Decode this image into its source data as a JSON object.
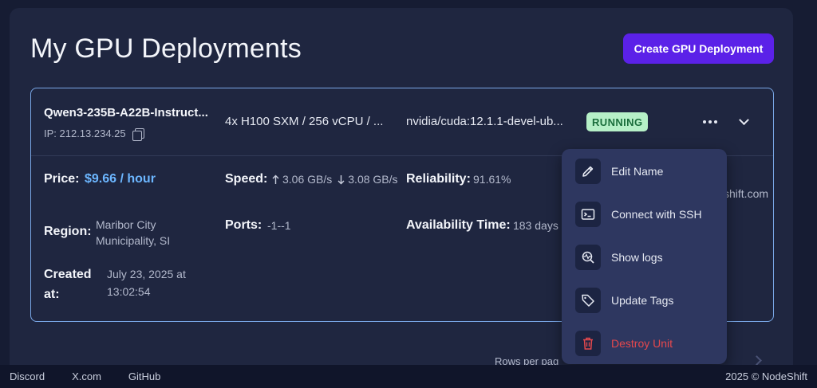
{
  "page": {
    "title": "My GPU Deployments",
    "create_label": "Create GPU Deployment"
  },
  "deployment": {
    "name": "Qwen3-235B-A22B-Instruct...",
    "ip": "IP: 212.13.234.25",
    "hardware": "4x H100 SXM / 256 vCPU / ...",
    "image": "nvidia/cuda:12.1.1-devel-ub...",
    "status": "RUNNING",
    "price_label": "Price:",
    "price_value": "$9.66 / hour",
    "speed_label": "Speed:",
    "speed_up": "3.06 GB/s",
    "speed_down": "3.08 GB/s",
    "reliability_label": "Reliability:",
    "reliability_value": "91.61%",
    "email_partial": "shift.com",
    "region_label": "Region:",
    "region_value_1": "Maribor City",
    "region_value_2": "Municipality, SI",
    "ports_label": "Ports:",
    "ports_value": "-1--1",
    "availability_label": "Availability Time:",
    "availability_value": "183 days",
    "created_label_1": "Created",
    "created_label_2": "at:",
    "created_value_1": "July 23, 2025 at",
    "created_value_2": "13:02:54"
  },
  "menu": {
    "items": [
      {
        "label": "Edit Name",
        "icon": "pencil-icon"
      },
      {
        "label": "Connect with SSH",
        "icon": "terminal-icon"
      },
      {
        "label": "Show logs",
        "icon": "logs-search-icon"
      },
      {
        "label": "Update Tags",
        "icon": "tag-icon"
      },
      {
        "label": "Destroy Unit",
        "icon": "trash-icon"
      }
    ]
  },
  "pagination": {
    "rows_per_page": "Rows per pag"
  },
  "footer": {
    "discord": "Discord",
    "x": "X.com",
    "github": "GitHub",
    "copyright": "2025 © NodeShift"
  },
  "colors": {
    "accent": "#5b21e8",
    "running_bg": "#b6f0c7",
    "running_text": "#1b6e3c",
    "price": "#6cb6ff",
    "danger": "#e5484d"
  }
}
